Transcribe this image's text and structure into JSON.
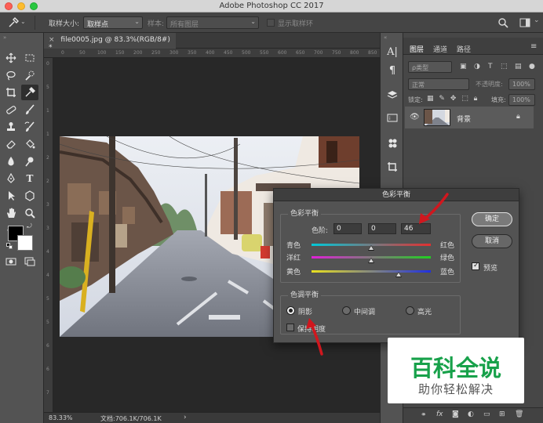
{
  "app": {
    "title": "Adobe Photoshop CC 2017"
  },
  "options_bar": {
    "sample_size_label": "取样大小:",
    "sample_size_value": "取样点",
    "sample_label": "样本:",
    "sample_value": "所有图层",
    "show_ring_label": "显示取样环"
  },
  "document": {
    "tab_title": "file0005.jpg @ 83.3%(RGB/8#) *",
    "zoom": "83.33%",
    "doc_info": "文档:706.1K/706.1K"
  },
  "rulers": {
    "h": [
      "0",
      "50",
      "100",
      "150",
      "200",
      "250",
      "300",
      "350",
      "400",
      "450",
      "500",
      "550",
      "600",
      "650",
      "700",
      "750",
      "800",
      "850",
      "900"
    ],
    "v": [
      "0",
      "5",
      "1",
      "1",
      "2",
      "2",
      "3",
      "3",
      "4",
      "4",
      "5",
      "5",
      "6",
      "6",
      "7"
    ]
  },
  "layers_panel": {
    "tabs": [
      "图层",
      "通道",
      "路径"
    ],
    "filter_value": "ρ类型",
    "blend_mode": "正常",
    "opacity_label": "不透明度:",
    "opacity_value": "100%",
    "lock_label": "锁定:",
    "fill_label": "填充:",
    "fill_value": "100%",
    "layer_name": "背景"
  },
  "color_balance_dialog": {
    "title": "色彩平衡",
    "color_balance_group": "色彩平衡",
    "levels_label": "色阶:",
    "levels": [
      "0",
      "0",
      "46"
    ],
    "sliders": [
      {
        "left": "青色",
        "right": "红色",
        "value": 0,
        "left_color": "#00c8d8",
        "right_color": "#e23030"
      },
      {
        "left": "洋红",
        "right": "绿色",
        "value": 0,
        "left_color": "#e020d8",
        "right_color": "#20d020"
      },
      {
        "left": "黄色",
        "right": "蓝色",
        "value": 46,
        "left_color": "#e8e020",
        "right_color": "#2030e0"
      }
    ],
    "tone_group": "色调平衡",
    "tones": [
      "阴影",
      "中间调",
      "高光"
    ],
    "selected_tone": "阴影",
    "preserve_luminosity": "保持明度",
    "ok_label": "确定",
    "cancel_label": "取消",
    "preview_label": "预览"
  },
  "watermark": {
    "title": "百科全说",
    "subtitle": "助你轻松解决"
  },
  "colors": {
    "accent": "#d0171e",
    "watermark_green": "#17a14a"
  }
}
